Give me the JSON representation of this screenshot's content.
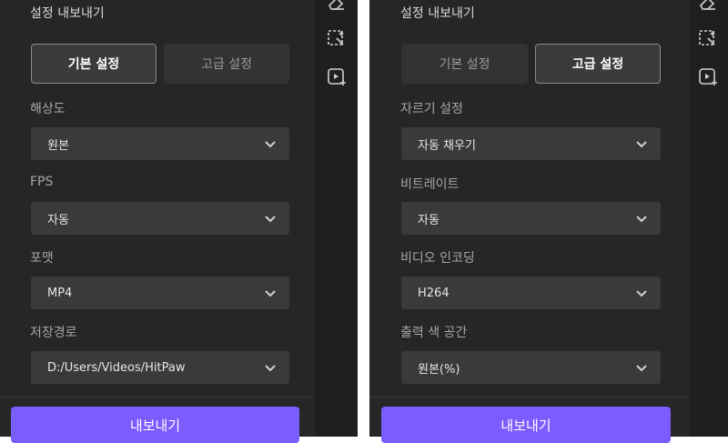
{
  "left_panel": {
    "title": "설정 내보내기",
    "tabs": [
      {
        "label": "기본 설정",
        "active": true
      },
      {
        "label": "고급 설정",
        "active": false
      }
    ],
    "fields": [
      {
        "label": "해상도",
        "value": "원본"
      },
      {
        "label": "FPS",
        "value": "자동"
      },
      {
        "label": "포맷",
        "value": "MP4"
      },
      {
        "label": "저장경로",
        "value": "D:/Users/Videos/HitPaw"
      }
    ],
    "export_label": "내보내기"
  },
  "right_panel": {
    "title": "설정 내보내기",
    "tabs": [
      {
        "label": "기본 설정",
        "active": false
      },
      {
        "label": "고급 설정",
        "active": true
      }
    ],
    "fields": [
      {
        "label": "자르기 설정",
        "value": "자동 채우기"
      },
      {
        "label": "비트레이트",
        "value": "자동"
      },
      {
        "label": "비디오 인코딩",
        "value": "H264"
      },
      {
        "label": "출력 색 공간",
        "value": "원본(%)"
      }
    ],
    "export_label": "내보내기"
  },
  "side_icons": [
    "eraser-icon",
    "selection-icon",
    "video-add-icon"
  ],
  "colors": {
    "panel_bg": "#262626",
    "select_bg": "#3a3a3a",
    "accent": "#7b5cff",
    "text": "#e6e6e6",
    "label": "#a6a6a6"
  }
}
